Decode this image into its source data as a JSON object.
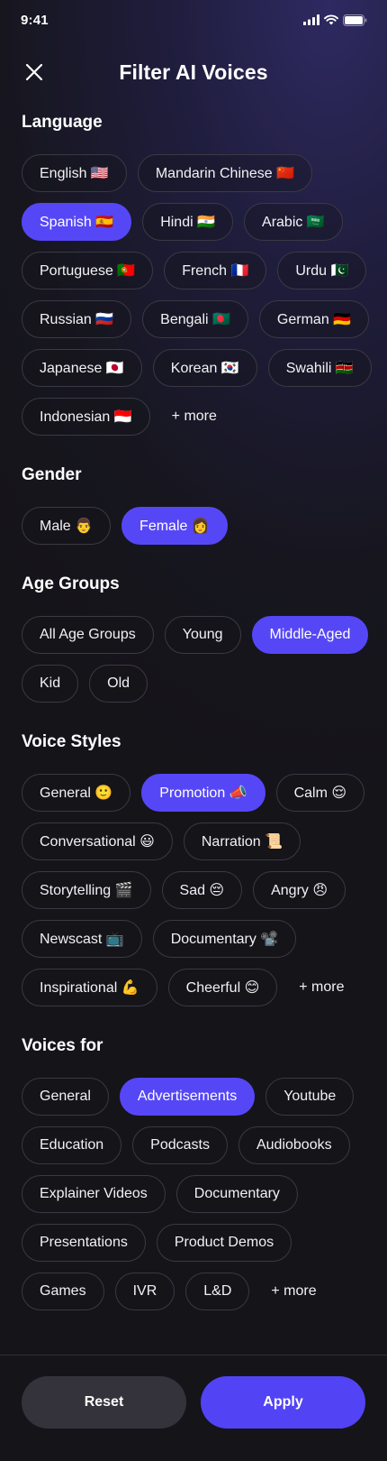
{
  "status": {
    "time": "9:41"
  },
  "header": {
    "title": "Filter AI Voices"
  },
  "sections": [
    {
      "title": "Language",
      "chips": [
        {
          "label": "English 🇺🇸",
          "selected": false
        },
        {
          "label": "Mandarin Chinese 🇨🇳",
          "selected": false
        },
        {
          "label": "Spanish 🇪🇸",
          "selected": true
        },
        {
          "label": "Hindi 🇮🇳",
          "selected": false
        },
        {
          "label": "Arabic 🇸🇦",
          "selected": false
        },
        {
          "label": "Portuguese 🇵🇹",
          "selected": false
        },
        {
          "label": "French 🇫🇷",
          "selected": false
        },
        {
          "label": "Urdu 🇵🇰",
          "selected": false
        },
        {
          "label": "Russian 🇷🇺",
          "selected": false
        },
        {
          "label": "Bengali 🇧🇩",
          "selected": false
        },
        {
          "label": "German 🇩🇪",
          "selected": false
        },
        {
          "label": "Japanese 🇯🇵",
          "selected": false
        },
        {
          "label": "Korean 🇰🇷",
          "selected": false
        },
        {
          "label": "Swahili 🇰🇪",
          "selected": false
        },
        {
          "label": "Indonesian 🇮🇩",
          "selected": false
        },
        {
          "label": "+ more",
          "more": true
        }
      ]
    },
    {
      "title": "Gender",
      "chips": [
        {
          "label": "Male 👨",
          "selected": false
        },
        {
          "label": "Female 👩",
          "selected": true
        }
      ]
    },
    {
      "title": "Age Groups",
      "chips": [
        {
          "label": "All Age Groups",
          "selected": false
        },
        {
          "label": "Young",
          "selected": false
        },
        {
          "label": "Middle-Aged",
          "selected": true
        },
        {
          "label": "Kid",
          "selected": false
        },
        {
          "label": "Old",
          "selected": false
        }
      ]
    },
    {
      "title": "Voice Styles",
      "chips": [
        {
          "label": "General 🙂",
          "selected": false
        },
        {
          "label": "Promotion 📣",
          "selected": true
        },
        {
          "label": "Calm 😌",
          "selected": false
        },
        {
          "label": "Conversational 😃",
          "selected": false
        },
        {
          "label": "Narration 📜",
          "selected": false
        },
        {
          "label": "Storytelling 🎬",
          "selected": false
        },
        {
          "label": "Sad 😔",
          "selected": false
        },
        {
          "label": "Angry 😠",
          "selected": false
        },
        {
          "label": "Newscast 📺",
          "selected": false
        },
        {
          "label": "Documentary 📽️",
          "selected": false
        },
        {
          "label": "Inspirational 💪",
          "selected": false
        },
        {
          "label": "Cheerful 😊",
          "selected": false
        },
        {
          "label": "+ more",
          "more": true
        }
      ]
    },
    {
      "title": "Voices for",
      "chips": [
        {
          "label": "General",
          "selected": false
        },
        {
          "label": "Advertisements",
          "selected": true
        },
        {
          "label": "Youtube",
          "selected": false
        },
        {
          "label": "Education",
          "selected": false
        },
        {
          "label": "Podcasts",
          "selected": false
        },
        {
          "label": "Audiobooks",
          "selected": false
        },
        {
          "label": "Explainer Videos",
          "selected": false
        },
        {
          "label": "Documentary",
          "selected": false
        },
        {
          "label": "Presentations",
          "selected": false
        },
        {
          "label": "Product Demos",
          "selected": false
        },
        {
          "label": "Games",
          "selected": false
        },
        {
          "label": "IVR",
          "selected": false
        },
        {
          "label": "L&D",
          "selected": false
        },
        {
          "label": "+ more",
          "more": true
        }
      ]
    }
  ],
  "footer": {
    "reset_label": "Reset",
    "apply_label": "Apply"
  },
  "colors": {
    "accent": "#5647f6",
    "background": "#17161f",
    "chip_border": "#3a3945",
    "reset_bg": "#34333b"
  }
}
